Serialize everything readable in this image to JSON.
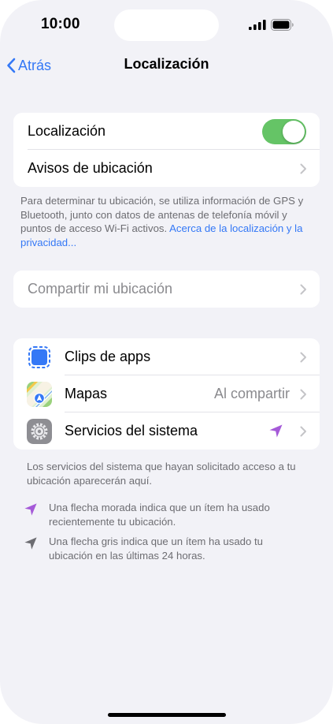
{
  "status_bar": {
    "time": "10:00"
  },
  "nav": {
    "back_label": "Atrás",
    "title": "Localización"
  },
  "location_group": {
    "toggle_label": "Localización",
    "toggle_on": true,
    "alerts_label": "Avisos de ubicación"
  },
  "location_footnote": {
    "text": "Para determinar tu ubicación, se utiliza información de GPS y Bluetooth, junto con datos de antenas de telefonía móvil y puntos de acceso Wi-Fi activos. ",
    "link": "Acerca de la localización y la privacidad..."
  },
  "share_row": {
    "label": "Compartir mi ubicación"
  },
  "apps_group": {
    "items": [
      {
        "label": "Clips de apps",
        "icon": "app-clips-icon",
        "value": ""
      },
      {
        "label": "Mapas",
        "icon": "maps-icon",
        "value": "Al compartir"
      },
      {
        "label": "Servicios del sistema",
        "icon": "settings-gear-icon",
        "value": "",
        "indicator": "purple-location-arrow"
      }
    ]
  },
  "system_footnote": "Los servicios del sistema que hayan solicitado acceso a tu ubicación aparecerán aquí.",
  "legend": {
    "purple": "Una flecha morada indica que un ítem ha usado recientemente tu ubicación.",
    "gray": "Una flecha gris indica que un ítem ha usado tu ubicación en las últimas 24 horas."
  },
  "colors": {
    "accent": "#3478f6",
    "toggle_on": "#65c466",
    "purple_arrow": "#a55ad8",
    "gray_arrow": "#6d6d72",
    "background": "#f2f2f7"
  }
}
